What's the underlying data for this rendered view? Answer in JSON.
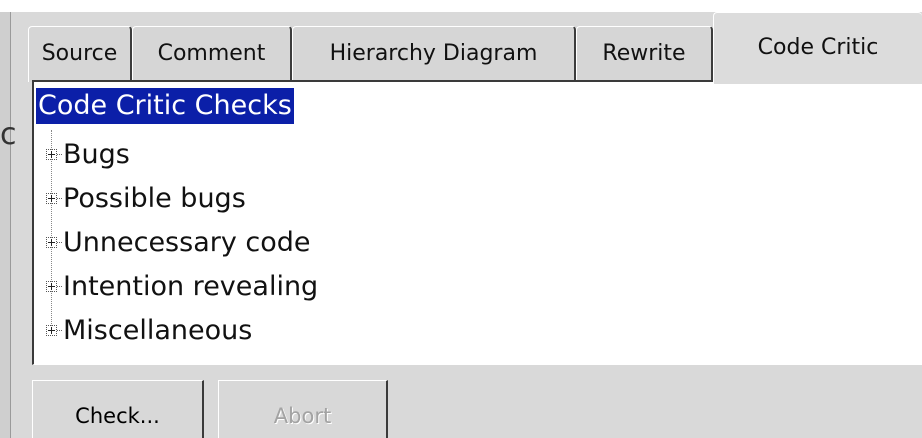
{
  "tabs": [
    {
      "label": "Source",
      "active": false
    },
    {
      "label": "Comment",
      "active": false
    },
    {
      "label": "Hierarchy Diagram",
      "active": false
    },
    {
      "label": "Rewrite",
      "active": false
    },
    {
      "label": "Code Critic",
      "active": true
    }
  ],
  "tree": {
    "root_label": "Code Critic Checks",
    "items": [
      {
        "label": "Bugs",
        "expander": "plus-icon"
      },
      {
        "label": "Possible bugs",
        "expander": "plus-icon"
      },
      {
        "label": "Unnecessary code",
        "expander": "plus-icon"
      },
      {
        "label": "Intention revealing",
        "expander": "plus-icon"
      },
      {
        "label": "Miscellaneous",
        "expander": "plus-icon"
      }
    ]
  },
  "buttons": {
    "check_label": "Check...",
    "abort_label": "Abort",
    "abort_enabled": false
  },
  "colors": {
    "selection_bg": "#0b1fa8",
    "window_bg": "#d9d9d9"
  }
}
